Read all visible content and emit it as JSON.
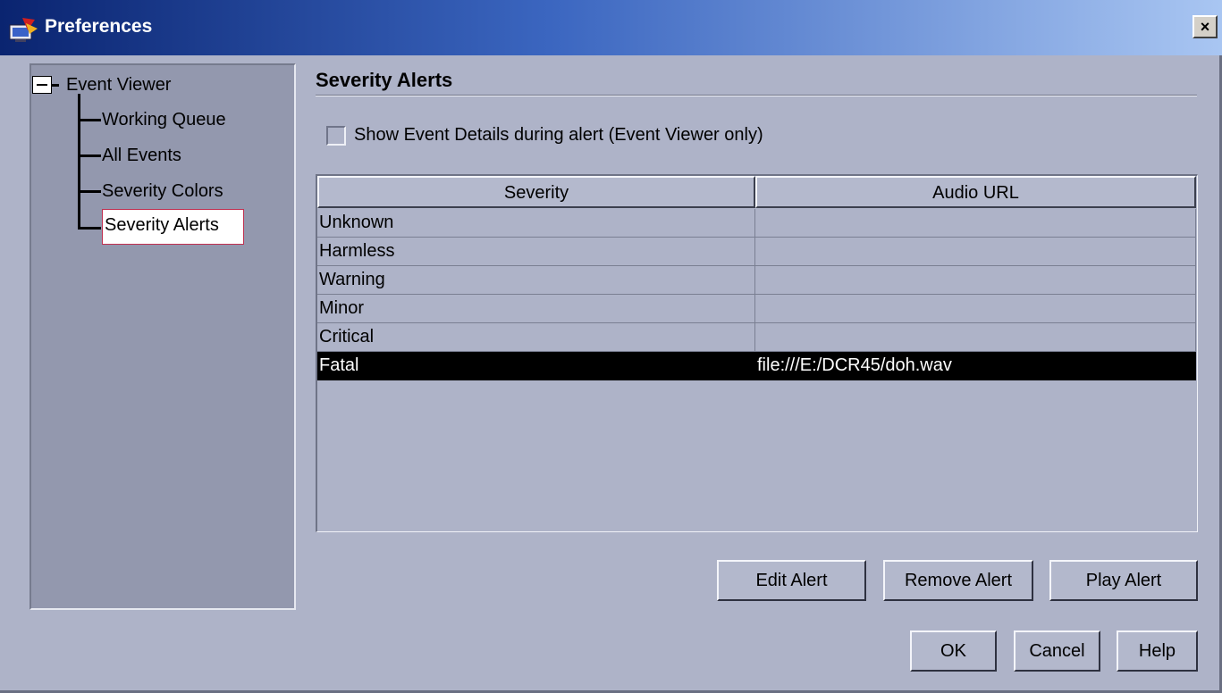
{
  "window": {
    "title": "Preferences",
    "close_symbol": "×"
  },
  "tree": {
    "root": {
      "label": "Event Viewer",
      "expanded": true
    },
    "children": [
      {
        "label": "Working Queue"
      },
      {
        "label": "All Events"
      },
      {
        "label": "Severity Colors"
      },
      {
        "label": "Severity Alerts",
        "selected": true
      }
    ]
  },
  "panel": {
    "title": "Severity Alerts",
    "checkbox": {
      "label": "Show Event Details during alert (Event Viewer only)",
      "checked": false
    },
    "table": {
      "columns": [
        "Severity",
        "Audio URL"
      ],
      "rows": [
        {
          "severity": "Unknown",
          "audio_url": ""
        },
        {
          "severity": "Harmless",
          "audio_url": ""
        },
        {
          "severity": "Warning",
          "audio_url": ""
        },
        {
          "severity": "Minor",
          "audio_url": ""
        },
        {
          "severity": "Critical",
          "audio_url": ""
        },
        {
          "severity": "Fatal",
          "audio_url": "file:///E:/DCR45/doh.wav",
          "selected": true
        }
      ]
    },
    "buttons": {
      "edit": "Edit Alert",
      "remove": "Remove Alert",
      "play": "Play Alert"
    }
  },
  "dialog_buttons": {
    "ok": "OK",
    "cancel": "Cancel",
    "help": "Help"
  },
  "colors": {
    "title_gradient_start": "#0a2470",
    "title_gradient_end": "#a9c6f2",
    "background": "#aeb3c8",
    "tree_background": "#9398ae",
    "selection": "#000000"
  },
  "icons": {
    "title_icon": "preferences-app-icon",
    "close_icon": "close-icon",
    "expander_icon": "collapse-minus-icon"
  }
}
